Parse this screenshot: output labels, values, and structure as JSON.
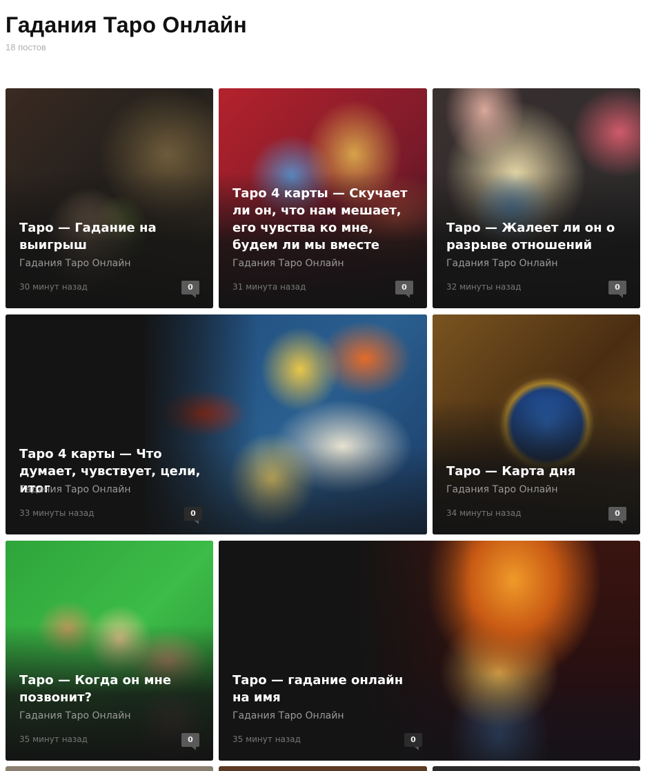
{
  "header": {
    "title": "Гадания Таро Онлайн",
    "post_count": "18 постов"
  },
  "posts": [
    {
      "title": "Таро — Гадание на выигрыш",
      "author": "Гадания Таро Онлайн",
      "time": "30 минут назад",
      "comments": "0"
    },
    {
      "title": "Таро 4 карты — Скучает ли он, что нам мешает, его чувства ко мне, будем ли мы вместе",
      "author": "Гадания Таро Онлайн",
      "time": "31 минута назад",
      "comments": "0"
    },
    {
      "title": "Таро — Жалеет ли он о разрыве отношений",
      "author": "Гадания Таро Онлайн",
      "time": "32 минуты назад",
      "comments": "0"
    },
    {
      "title": "Таро 4 карты — Что думает, чувствует, цели, итог",
      "author": "Гадания Таро Онлайн",
      "time": "33 минуты назад",
      "comments": "0"
    },
    {
      "title": "Таро — Карта дня",
      "author": "Гадания Таро Онлайн",
      "time": "34 минуты назад",
      "comments": "0"
    },
    {
      "title": "Таро — Когда он мне позвонит?",
      "author": "Гадания Таро Онлайн",
      "time": "35 минут назад",
      "comments": "0"
    },
    {
      "title": "Таро — гадание онлайн на имя",
      "author": "Гадания Таро Онлайн",
      "time": "35 минут назад",
      "comments": "0"
    }
  ]
}
